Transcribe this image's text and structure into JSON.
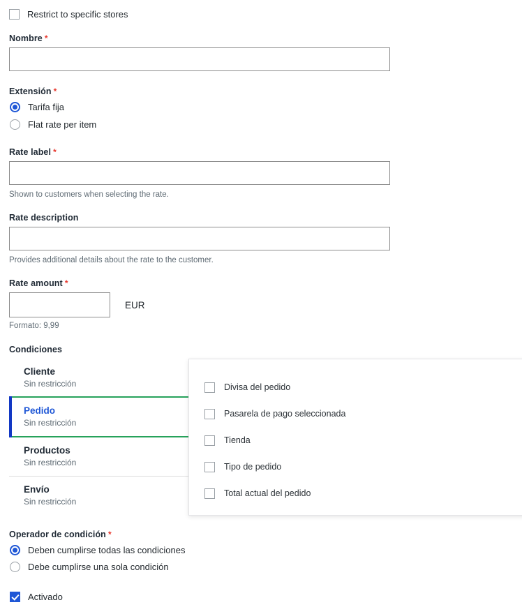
{
  "form": {
    "restrict_stores": {
      "label": "Restrict to specific stores",
      "checked": false
    },
    "nombre": {
      "label": "Nombre",
      "required_marker": "*",
      "value": "",
      "placeholder": ""
    },
    "extension": {
      "label": "Extensión",
      "required_marker": "*",
      "options": [
        {
          "label": "Tarifa fija",
          "selected": true
        },
        {
          "label": "Flat rate per item",
          "selected": false
        }
      ]
    },
    "rate_label": {
      "label": "Rate label",
      "required_marker": "*",
      "value": "",
      "placeholder": "",
      "hint": "Shown to customers when selecting the rate."
    },
    "rate_description": {
      "label": "Rate description",
      "required_marker": "",
      "value": "",
      "placeholder": "",
      "hint": "Provides additional details about the rate to the customer."
    },
    "rate_amount": {
      "label": "Rate amount",
      "required_marker": "*",
      "value": "",
      "placeholder": "",
      "currency": "EUR",
      "hint": "Formato: 9,99"
    },
    "conditions": {
      "label": "Condiciones",
      "items": [
        {
          "title": "Cliente",
          "subtitle": "Sin restricción",
          "selected": false,
          "divider_after": false
        },
        {
          "title": "Pedido",
          "subtitle": "Sin restricción",
          "selected": true,
          "divider_after": false
        },
        {
          "title": "Productos",
          "subtitle": "Sin restricción",
          "selected": false,
          "divider_after": true
        },
        {
          "title": "Envío",
          "subtitle": "Sin restricción",
          "selected": false,
          "divider_after": false
        }
      ]
    },
    "condition_dropdown": {
      "items": [
        {
          "label": "Divisa del pedido",
          "checked": false
        },
        {
          "label": "Pasarela de pago seleccionada",
          "checked": false
        },
        {
          "label": "Tienda",
          "checked": false
        },
        {
          "label": "Tipo de pedido",
          "checked": false
        },
        {
          "label": "Total actual del pedido",
          "checked": false
        }
      ]
    },
    "condition_operator": {
      "label": "Operador de condición",
      "required_marker": "*",
      "options": [
        {
          "label": "Deben cumplirse todas las condiciones",
          "selected": true
        },
        {
          "label": "Debe cumplirse una sola condición",
          "selected": false
        }
      ]
    },
    "enabled": {
      "label": "Activado",
      "checked": true
    }
  },
  "colors": {
    "accent_blue": "#1f57d6",
    "selected_border_green": "#27a25b",
    "selected_bar_blue": "#1238c4",
    "required_red": "#e8392f",
    "input_border": "#8c8c8c",
    "muted_text": "#5f6b74"
  }
}
